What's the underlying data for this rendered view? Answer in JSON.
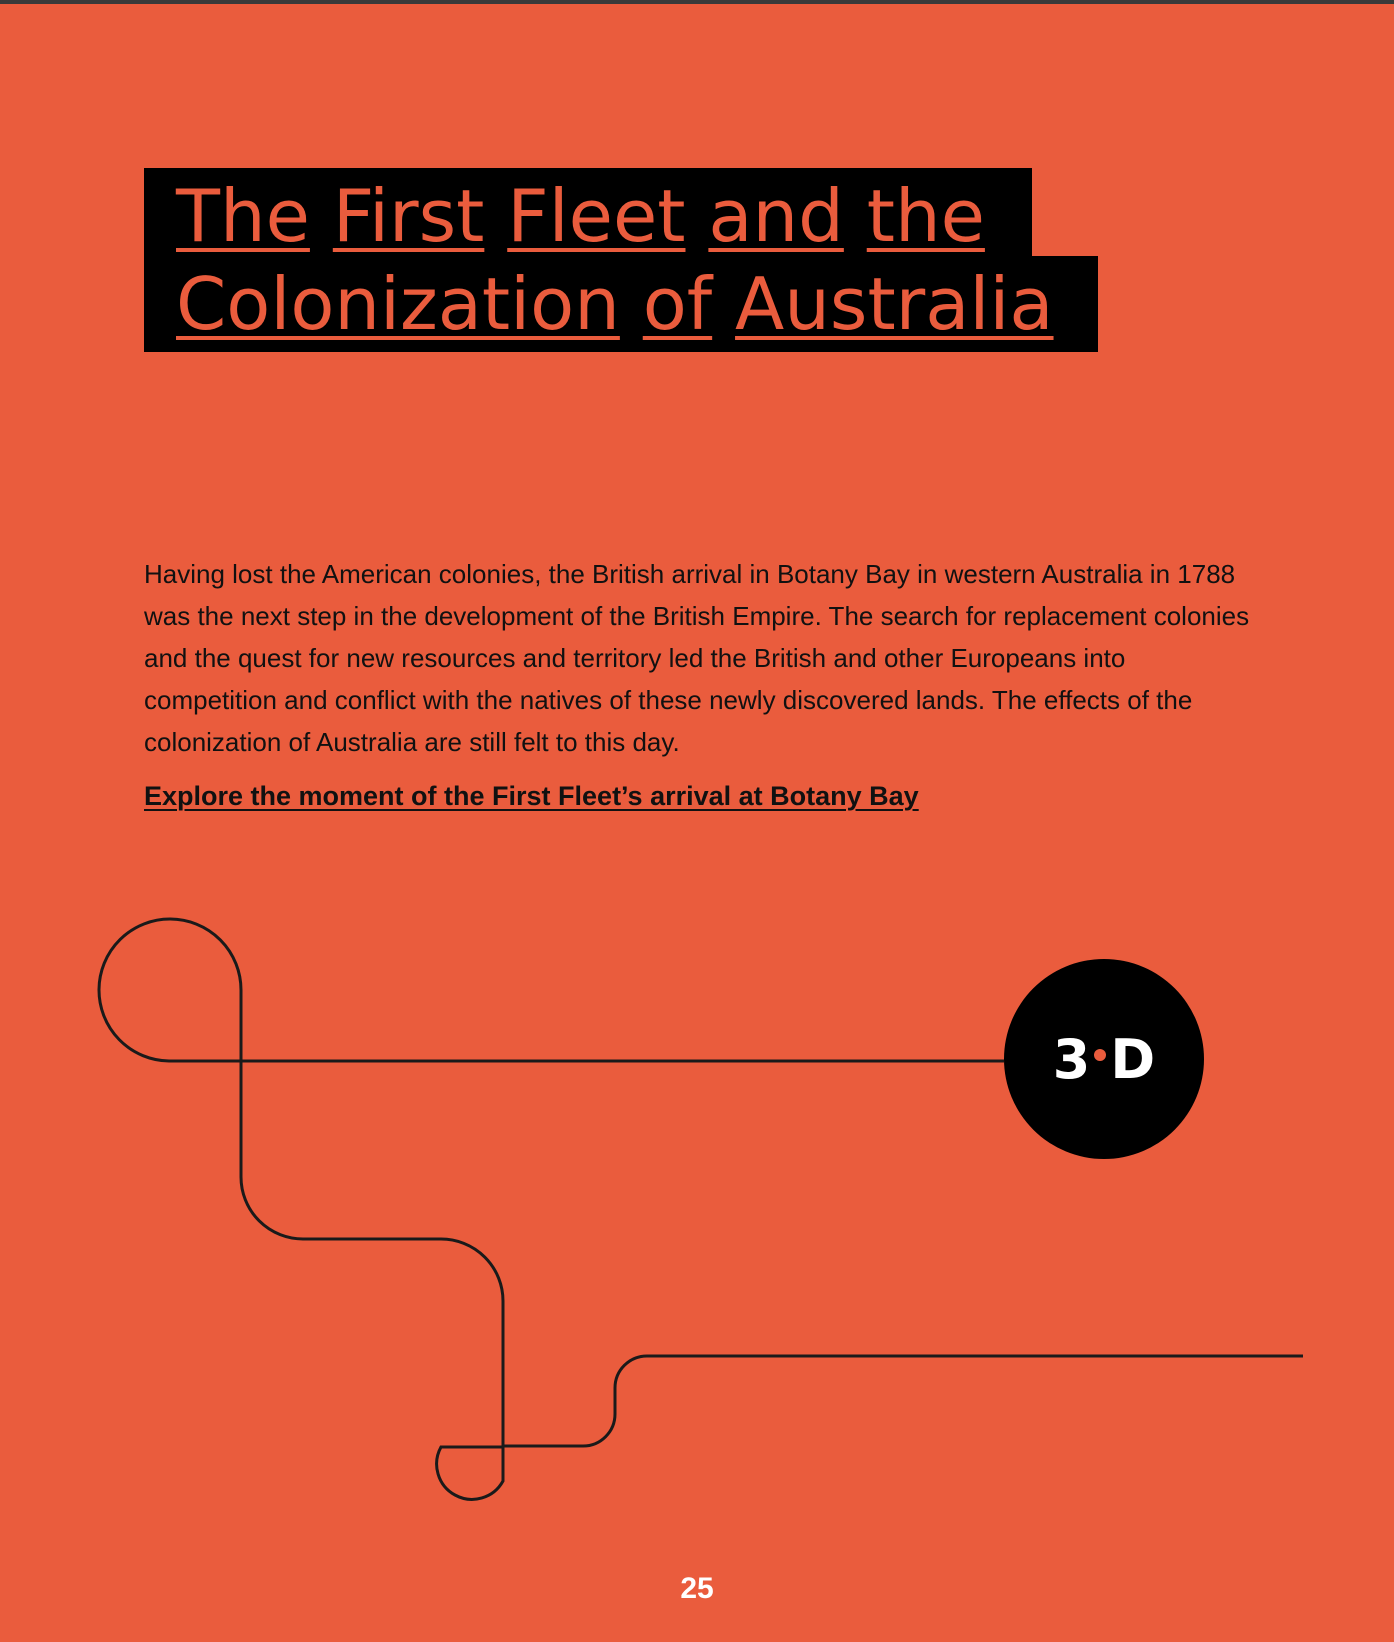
{
  "title": {
    "line1_words": [
      "The",
      "First",
      "Fleet",
      "and",
      "the"
    ],
    "line2_words": [
      "Colonization",
      "of",
      "Australia"
    ]
  },
  "intro": "Having lost the American colonies, the British arrival in Botany Bay in western Australia in 1788 was the next step in the development of the British Empire. The search for replacement colonies and the quest for new resources and territory led the British and other Europeans into competition and conflict with the natives of these newly discovered lands. The effects of the colonization of Australia are still felt to this day.",
  "explore_link": "Explore the moment of the First Fleet’s arrival at Botany Bay",
  "badge": {
    "left": "3",
    "right": "D"
  },
  "page_number": "25",
  "colors": {
    "background": "#ea5c3d",
    "title_block": "#000000",
    "line": "#1a1a1a",
    "badge_dot": "#ea5c3d"
  }
}
